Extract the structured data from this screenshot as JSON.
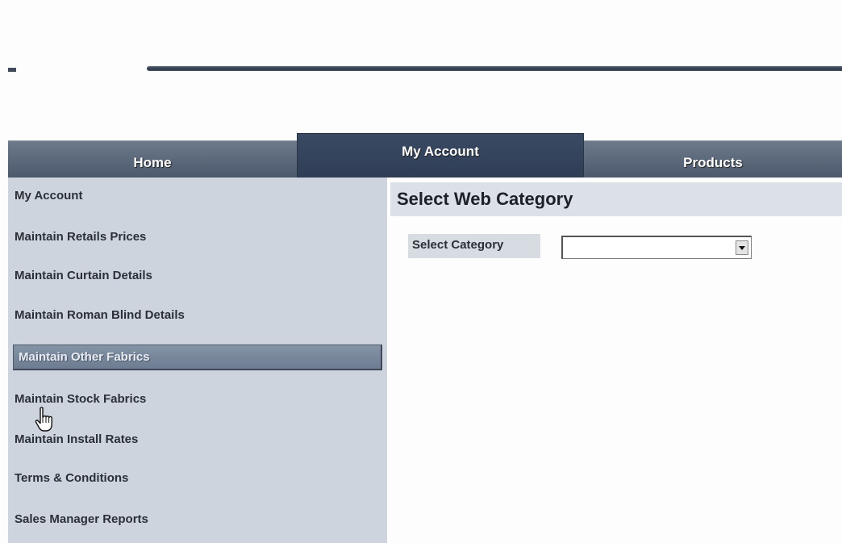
{
  "nav": {
    "tabs": [
      {
        "label": "Home"
      },
      {
        "label": "My Account"
      },
      {
        "label": "Products"
      }
    ],
    "active_tab": "My Account"
  },
  "sidebar": {
    "items": [
      {
        "label": "My Account"
      },
      {
        "label": "Maintain Retails Prices"
      },
      {
        "label": "Maintain Curtain Details"
      },
      {
        "label": "Maintain Roman Blind Details"
      },
      {
        "label": "Maintain Other Fabrics"
      },
      {
        "label": "Maintain Stock Fabrics"
      },
      {
        "label": "Maintain Install Rates"
      },
      {
        "label": "Terms & Conditions"
      },
      {
        "label": "Sales Manager Reports"
      }
    ],
    "selected_item": "Maintain Other Fabrics"
  },
  "main": {
    "title": "Select Web Category",
    "category_field": {
      "label": "Select Category",
      "value": ""
    }
  },
  "colors": {
    "nav_tab": "#4c596c",
    "nav_tab_active": "#2f3e55",
    "sidebar_bg": "#cdd4de",
    "sidebar_selected": "#7a889c"
  },
  "icons": {
    "pointer": "hand-pointer-icon",
    "dropdown": "chevron-down-icon"
  }
}
